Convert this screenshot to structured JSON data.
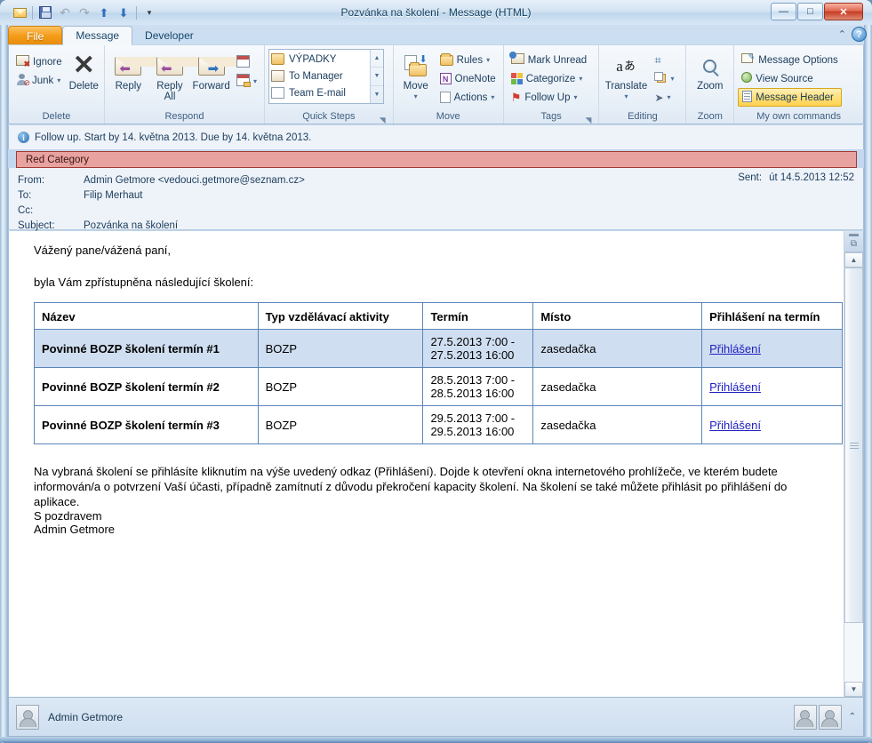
{
  "window": {
    "title": "Pozvánka na školení  -  Message (HTML)",
    "controls": {
      "minimize": "—",
      "maximize": "□",
      "close": "✕"
    }
  },
  "quick_access": {
    "items": [
      {
        "name": "mail-icon",
        "label": ""
      },
      {
        "name": "save-icon",
        "label": ""
      },
      {
        "name": "undo-icon",
        "label": "↶"
      },
      {
        "name": "redo-icon",
        "label": "↷"
      },
      {
        "name": "previous-item-icon",
        "label": "▲"
      },
      {
        "name": "next-item-icon",
        "label": "▼"
      },
      {
        "name": "customize-qat-icon",
        "label": "▼"
      }
    ]
  },
  "tabs": [
    {
      "label": "File",
      "active": false,
      "style": "file"
    },
    {
      "label": "Message",
      "active": true,
      "style": "normal"
    },
    {
      "label": "Developer",
      "active": false,
      "style": "normal"
    }
  ],
  "help": {
    "collapse_ribbon": "⌃",
    "help": "?"
  },
  "ribbon": {
    "groups": [
      {
        "name": "delete",
        "label": "Delete",
        "small_buttons": [
          {
            "label": "Ignore",
            "icon": "ignore-icon",
            "caret": false
          },
          {
            "label": "Junk",
            "icon": "junk-icon",
            "caret": true
          }
        ],
        "big_buttons": [
          {
            "label": "Delete",
            "icon": "delete-x-icon"
          }
        ]
      },
      {
        "name": "respond",
        "label": "Respond",
        "big_buttons": [
          {
            "label": "Reply",
            "icon": "reply-icon"
          },
          {
            "label": "Reply All",
            "icon": "reply-all-icon"
          },
          {
            "label": "Forward",
            "icon": "forward-icon"
          }
        ],
        "extra": [
          {
            "label": "",
            "icon": "meeting-icon",
            "caret": false
          },
          {
            "label": "",
            "icon": "more-respond-icon",
            "caret": true
          }
        ]
      },
      {
        "name": "quick-steps",
        "label": "Quick Steps",
        "gallery": [
          {
            "label": "VÝPADKY",
            "icon": "quickstep-folder-icon"
          },
          {
            "label": "To Manager",
            "icon": "quickstep-forward-icon"
          },
          {
            "label": "Team E-mail",
            "icon": "quickstep-email-icon"
          }
        ],
        "has_dialog_launcher": true
      },
      {
        "name": "move",
        "label": "Move",
        "big_buttons": [
          {
            "label": "Move",
            "icon": "move-folder-icon",
            "caret": true
          }
        ],
        "small_buttons": [
          {
            "label": "Rules",
            "icon": "rules-icon",
            "caret": true
          },
          {
            "label": "OneNote",
            "icon": "onenote-icon",
            "caret": false
          },
          {
            "label": "Actions",
            "icon": "actions-icon",
            "caret": true
          }
        ]
      },
      {
        "name": "tags",
        "label": "Tags",
        "small_buttons": [
          {
            "label": "Mark Unread",
            "icon": "mark-unread-icon",
            "caret": false
          },
          {
            "label": "Categorize",
            "icon": "categorize-icon",
            "caret": true
          },
          {
            "label": "Follow Up",
            "icon": "follow-up-flag-icon",
            "caret": true
          }
        ],
        "has_dialog_launcher": true
      },
      {
        "name": "editing",
        "label": "Editing",
        "big_buttons": [
          {
            "label": "Translate",
            "icon": "translate-icon",
            "caret": true
          }
        ],
        "small_buttons": [
          {
            "label": "",
            "icon": "find-binoculars-icon",
            "caret": false
          },
          {
            "label": "",
            "icon": "related-copy-icon",
            "caret": true
          },
          {
            "label": "",
            "icon": "select-pointer-icon",
            "caret": true
          }
        ]
      },
      {
        "name": "zoom",
        "label": "Zoom",
        "big_buttons": [
          {
            "label": "Zoom",
            "icon": "zoom-magnifier-icon"
          }
        ]
      },
      {
        "name": "my-own-commands",
        "label": "My own commands",
        "small_buttons": [
          {
            "label": "Message Options",
            "icon": "message-options-icon",
            "caret": false,
            "highlight": false
          },
          {
            "label": "View Source",
            "icon": "view-source-icon",
            "caret": false,
            "highlight": false
          },
          {
            "label": "Message Header",
            "icon": "message-header-icon",
            "caret": false,
            "highlight": true
          }
        ]
      }
    ]
  },
  "infobar": {
    "icon": "info-icon",
    "text": "Follow up.  Start by 14. května 2013.  Due by 14. května 2013."
  },
  "category": {
    "label": "Red Category",
    "color": "#e8a3a0",
    "border_color": "#a03a34"
  },
  "header_fields": {
    "from_label": "From:",
    "from_value": "Admin Getmore <vedouci.getmore@seznam.cz>",
    "to_label": "To:",
    "to_value": "Filip Merhaut",
    "cc_label": "Cc:",
    "cc_value": "",
    "subject_label": "Subject:",
    "subject_value": "Pozvánka na školení",
    "sent_label": "Sent:",
    "sent_value": "út 14.5.2013 12:52"
  },
  "body": {
    "greeting": "Vážený pane/vážená paní,",
    "intro": "byla Vám zpřístupněna následující školení:",
    "table": {
      "headers": [
        "Název",
        "Typ vzdělávací aktivity",
        "Termín",
        "Místo",
        "Přihlášení na termín"
      ],
      "rows": [
        {
          "name": "Povinné BOZP školení termín #1",
          "type": "BOZP",
          "term": "27.5.2013 7:00 - 27.5.2013 16:00",
          "place": "zasedačka",
          "signup": "Přihlášení",
          "selected": true
        },
        {
          "name": "Povinné BOZP školení termín #2",
          "type": "BOZP",
          "term": "28.5.2013 7:00 - 28.5.2013 16:00",
          "place": "zasedačka",
          "signup": "Přihlášení",
          "selected": false
        },
        {
          "name": "Povinné BOZP školení termín #3",
          "type": "BOZP",
          "term": "29.5.2013 7:00 - 29.5.2013 16:00",
          "place": "zasedačka",
          "signup": "Přihlášení",
          "selected": false
        }
      ]
    },
    "closing_paragraph": "Na vybraná školení se přihlásíte kliknutím na výše uvedený odkaz (Přihlášení). Dojde k otevření okna internetového prohlížeče, ve kterém budete informován/a o potvrzení Vaší účasti, případně zamítnutí z důvodu překročení kapacity školení. Na školení se také můžete přihlásit po přihlášení do aplikace.",
    "signature_line1": "S pozdravem",
    "signature_line2": "Admin Getmore"
  },
  "scrollbar": {
    "up_arrow": "▲",
    "down_arrow": "▼",
    "split_handle": "split-window-handle"
  },
  "statusbar": {
    "name": "Admin Getmore",
    "expand_chevron": "⌃"
  },
  "colors": {
    "file_tab": "#f39c18",
    "category_red": "#e8a3a0",
    "link_blue": "#2020c0",
    "selected_row": "#cfdef0",
    "table_border": "#5b85b8"
  }
}
